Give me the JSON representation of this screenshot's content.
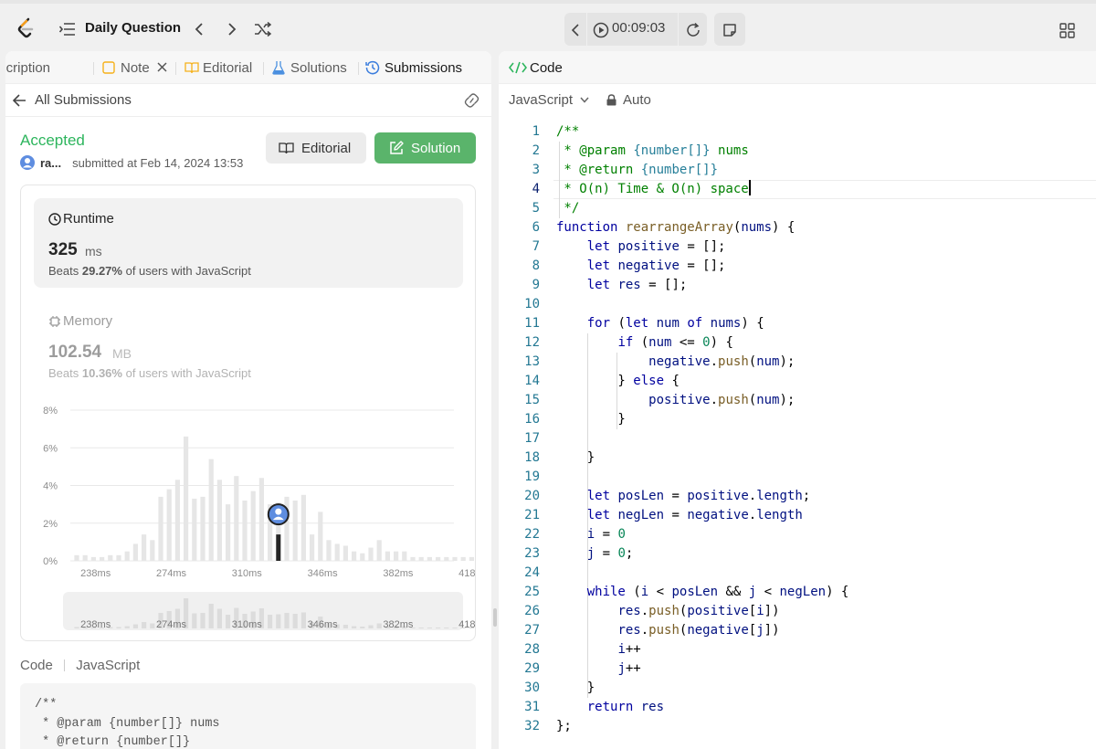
{
  "topbar": {
    "title": "Daily Question",
    "timer": "00:09:03"
  },
  "left": {
    "tabs": [
      {
        "label": "Description"
      },
      {
        "label": "Note"
      },
      {
        "label": "Editorial"
      },
      {
        "label": "Solutions"
      },
      {
        "label": "Submissions"
      }
    ],
    "back_label": "All Submissions",
    "status": "Accepted",
    "user": "ra...",
    "submitted_text": "submitted at Feb 14, 2024 13:53",
    "editorial_button": "Editorial",
    "solution_button": "Solution",
    "runtime": {
      "label": "Runtime",
      "value": "325",
      "unit": "ms",
      "beats_prefix": "Beats",
      "beats_pct": "29.27%",
      "beats_suffix": "of users with JavaScript"
    },
    "memory": {
      "label": "Memory",
      "value": "102.54",
      "unit": "MB",
      "beats_prefix": "Beats",
      "beats_pct": "10.36%",
      "beats_suffix": "of users with JavaScript"
    },
    "code_header": {
      "label": "Code",
      "lang": "JavaScript"
    },
    "code_preview": [
      "/**",
      " * @param {number[]} nums",
      " * @return {number[]}"
    ]
  },
  "chart_data": {
    "type": "bar",
    "ylabel_ticks": [
      "0%",
      "2%",
      "4%",
      "6%",
      "8%"
    ],
    "ylim": [
      0,
      8
    ],
    "x_ticks": [
      "238ms",
      "274ms",
      "310ms",
      "346ms",
      "382ms",
      "418ms"
    ],
    "x_start_ms": 229,
    "bin_ms": 4,
    "values": [
      0.3,
      0.3,
      0.2,
      0.2,
      0.3,
      0.3,
      0.5,
      0.9,
      1.4,
      1.1,
      3.4,
      3.8,
      4.3,
      6.6,
      3.3,
      3.4,
      5.4,
      4.3,
      3.0,
      4.5,
      3.2,
      3.7,
      4.4,
      3.0,
      3.1,
      3.4,
      3.2,
      3.5,
      1.4,
      2.6,
      1.1,
      0.9,
      0.8,
      0.5,
      0.4,
      0.7,
      1.1,
      0.5,
      0.5,
      0.5,
      0.2,
      0.2,
      0.2,
      0.2,
      0.2,
      0.2,
      0.2,
      0.2,
      0.2,
      0.2,
      0.2,
      0.2,
      0.2,
      0.2,
      0.2,
      0.2
    ],
    "highlight_value": 1.4,
    "highlight_ms": 325
  },
  "editor": {
    "header": "Code",
    "language": "JavaScript",
    "mode": "Auto",
    "current_line": 4,
    "lines": [
      "/**",
      " * @param {number[]} nums",
      " * @return {number[]}",
      " * O(n) Time & O(n) space",
      " */",
      "function rearrangeArray(nums) {",
      "    let positive = [];",
      "    let negative = [];",
      "    let res = [];",
      "",
      "    for (let num of nums) {",
      "        if (num <= 0) {",
      "            negative.push(num);",
      "        } else {",
      "            positive.push(num);",
      "        }",
      "",
      "    }",
      "",
      "    let posLen = positive.length;",
      "    let negLen = negative.length",
      "    i = 0",
      "    j = 0;",
      "",
      "    while (i < posLen && j < negLen) {",
      "        res.push(positive[i])",
      "        res.push(negative[j])",
      "        i++",
      "        j++",
      "    }",
      "    return res",
      "};"
    ]
  }
}
